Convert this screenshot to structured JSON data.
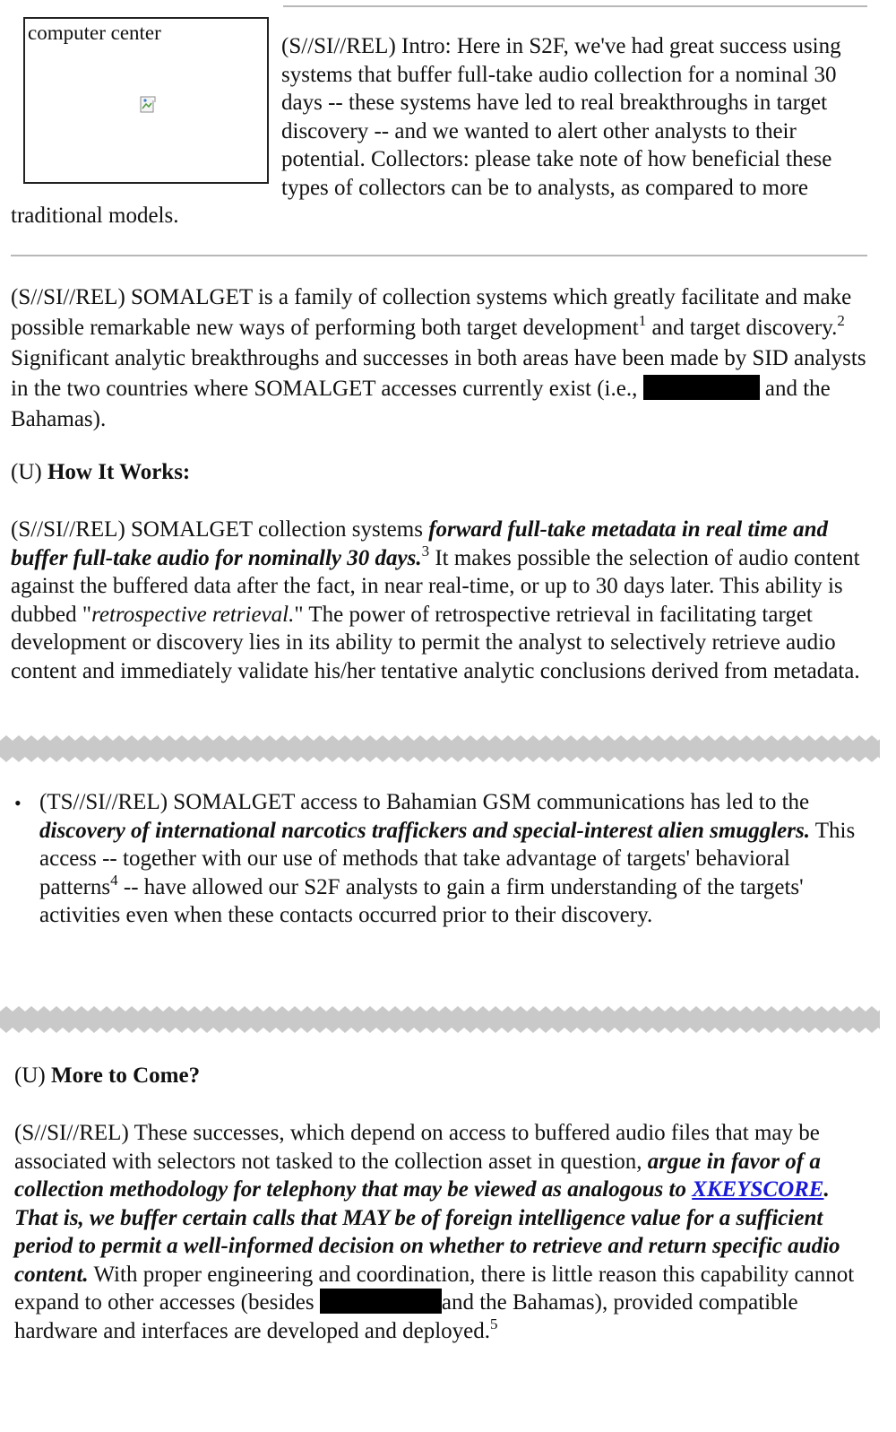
{
  "image_caption": "computer center",
  "intro": {
    "marking": "(S//SI//REL)",
    "text": "Intro: Here in S2F, we've had great success using systems that buffer full-take audio collection for a nominal 30 days -- these systems have led to real breakthroughs in target discovery -- and we wanted to alert other analysts to their potential. Collectors: please take note of how beneficial these types of collectors can be to analysts, as compared to more traditional models."
  },
  "p1": {
    "a": "(S//SI//REL) SOMALGET is a family of collection systems which greatly facilitate and make possible remarkable new ways of performing both target development",
    "sup1": "1",
    "b": " and target discovery.",
    "sup2": "2",
    "c": " Significant analytic breakthroughs and successes in both areas have been made by SID analysts in the two countries where SOMALGET accesses currently exist (i.e., ",
    "d": " and the Bahamas)."
  },
  "heading1": {
    "marking": "(U) ",
    "title": "How It Works:"
  },
  "p2": {
    "a": "(S//SI//REL) SOMALGET collection systems ",
    "bold": "forward full-take metadata in real time and buffer full-take audio for nominally 30 days.",
    "sup": "3",
    "b": " It makes possible the selection of audio content against the buffered data after the fact, in near real-time, or up to 30 days later. This ability is dubbed \"",
    "ital": "retrospective retrieval.",
    "c": "\" The power of retrospective retrieval in facilitating target development or discovery lies in its ability to permit the analyst to selectively retrieve audio content and immediately validate his/her tentative analytic conclusions derived from metadata."
  },
  "bullet": {
    "a": "(TS//SI//REL) SOMALGET access to Bahamian GSM communications has led to the ",
    "bold": "discovery of international narcotics traffickers and special-interest alien smugglers.",
    "b": " This access -- together with our use of methods that take advantage of targets' behavioral patterns",
    "sup": "4",
    "c": " -- have allowed our S2F analysts to gain a firm understanding of the targets' activities even when these contacts occurred prior to their discovery."
  },
  "heading2": {
    "marking": "(U) ",
    "title": "More to Come?"
  },
  "p3": {
    "a": "(S//SI//REL) These successes, which depend on access to buffered audio files that may be associated with selectors not tasked to the collection asset in question, ",
    "bold1": "argue in favor of a collection methodology for telephony that may be viewed as analogous to ",
    "link": "XKEYSCORE",
    "bold2": ". That is, we buffer certain calls that MAY be of foreign intelligence value for a sufficient period to permit a well-informed decision on whether to retrieve and return specific audio content.",
    "b": " With proper engineering and coordination, there is little reason this capability cannot expand to other accesses (besides ",
    "c": "and the Bahamas), provided compatible hardware and interfaces are developed and deployed.",
    "sup": "5"
  }
}
